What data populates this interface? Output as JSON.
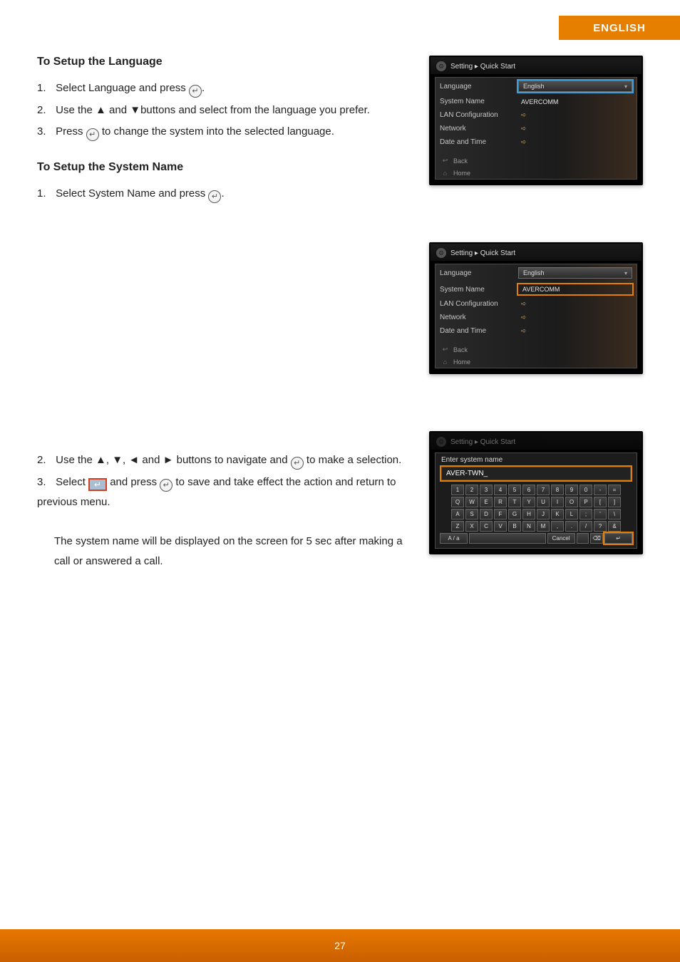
{
  "language_tab": "ENGLISH",
  "section1": {
    "heading": "To Setup the Language",
    "items": [
      {
        "num": "1.",
        "html_parts": [
          "Select Language and press ",
          {
            "icon": "enter"
          },
          "."
        ]
      },
      {
        "num": "2.",
        "html_parts": [
          "Use the ▲ and ▼buttons and select from the language you prefer."
        ]
      },
      {
        "num": "3.",
        "html_parts": [
          "Press ",
          {
            "icon": "enter"
          },
          " to change the system into the selected language."
        ]
      }
    ]
  },
  "section2": {
    "heading": "To Setup the System Name",
    "items": [
      {
        "num": "1.",
        "html_parts": [
          "Select System Name and press ",
          {
            "icon": "enter"
          },
          "."
        ]
      }
    ]
  },
  "lower": {
    "items": [
      {
        "num": "2.",
        "html_parts": [
          "Use the ▲, ▼, ◄ and ► buttons to navigate and ",
          {
            "icon": "enter"
          },
          " to make a selection."
        ]
      },
      {
        "num": "3.",
        "html_parts": [
          "Select ",
          {
            "icon": "return"
          },
          " and press ",
          {
            "icon": "enter"
          },
          " to save and take effect the action and return to previous menu."
        ]
      }
    ],
    "note1": "The system name will be displayed on the screen for 5 sec after making a call or answered a call."
  },
  "shot_common": {
    "breadcrumb": "Setting ▸ Quick Start",
    "rows": {
      "language": "Language",
      "system_name": "System Name",
      "lan": "LAN Configuration",
      "network": "Network",
      "datetime": "Date and Time"
    },
    "values": {
      "language_sel": "English",
      "system_name": "AVERCOMM"
    },
    "nav": {
      "back": "Back",
      "home": "Home"
    }
  },
  "shot3": {
    "breadcrumb": "Setting ▸ Quick Start",
    "title": "Enter system name",
    "input": "AVER-TWN_",
    "keys": {
      "row1": [
        "1",
        "2",
        "3",
        "4",
        "5",
        "6",
        "7",
        "8",
        "9",
        "0",
        "-",
        "="
      ],
      "row2": [
        "Q",
        "W",
        "E",
        "R",
        "T",
        "Y",
        "U",
        "I",
        "O",
        "P",
        "[",
        "]"
      ],
      "row3": [
        "A",
        "S",
        "D",
        "F",
        "G",
        "H",
        "J",
        "K",
        "L",
        ";",
        "'",
        "\\"
      ],
      "row4": [
        "Z",
        "X",
        "C",
        "V",
        "B",
        "N",
        "M",
        ",",
        ".",
        "/",
        "?",
        "&"
      ],
      "row5_mode": "A / a",
      "row5_cancel": "Cancel",
      "row5_space": " ",
      "row5_bksp": "⌫",
      "row5_enter": "↵"
    }
  },
  "icons": {
    "enter_glyph": "↵",
    "return_glyph": "↵",
    "arrow_right": "➪",
    "gear": "⚙",
    "back": "↩",
    "home": "⌂"
  },
  "page_number": "27"
}
